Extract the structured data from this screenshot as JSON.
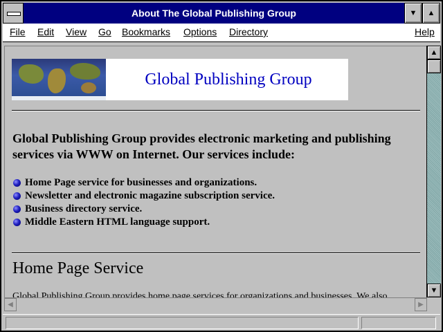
{
  "window": {
    "title": "About The Global Publishing Group"
  },
  "menu": {
    "file": "File",
    "edit": "Edit",
    "view": "View",
    "go": "Go",
    "bookmarks": "Bookmarks",
    "options": "Options",
    "directory": "Directory",
    "help": "Help"
  },
  "page": {
    "banner_title": "Global Publishing Group",
    "intro": "Global Publishing Group provides electronic marketing and publishing services via WWW on Internet. Our services include:",
    "services": [
      "Home Page service for businesses and organizations.",
      "Newsletter and electronic magazine subscription service.",
      "Business directory service.",
      "Middle Eastern HTML language support."
    ],
    "section_heading": "Home Page Service",
    "section_paragraph": "Global Publishing Group provides home page services for organizations and businesses. We also"
  },
  "status": {
    "text": ""
  },
  "icons": {
    "system_menu": "system-menu-icon",
    "minimize": "minimize-icon",
    "maximize": "maximize-icon",
    "scroll_up": "arrow-up-icon",
    "scroll_down": "arrow-down-icon",
    "scroll_left": "arrow-left-icon",
    "scroll_right": "arrow-right-icon",
    "bullet": "blue-ball-bullet-icon",
    "globe_map": "world-map-image"
  },
  "colors": {
    "title_bar": "#000080",
    "banner_text": "#0000c0",
    "background": "#c0c0c0",
    "scroll_track": "#8fb5b5"
  }
}
